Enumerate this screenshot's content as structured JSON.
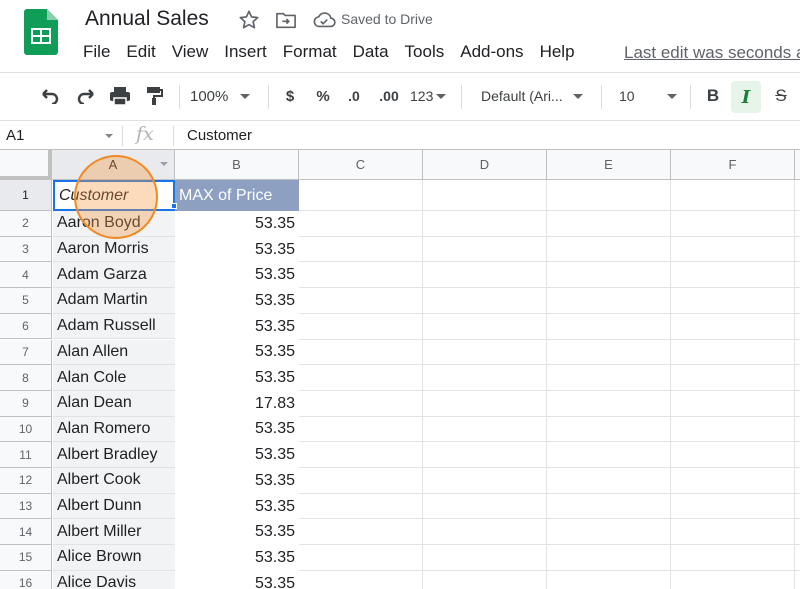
{
  "app": {
    "title": "Annual Sales",
    "saved_status": "Saved to Drive",
    "last_edit": "Last edit was seconds ago"
  },
  "menu": [
    "File",
    "Edit",
    "View",
    "Insert",
    "Format",
    "Data",
    "Tools",
    "Add-ons",
    "Help"
  ],
  "toolbar": {
    "zoom": "100%",
    "currency": "$",
    "percent": "%",
    "decrease_decimals": ".0",
    "increase_decimals": ".00",
    "more_formats": "123",
    "font": "Default (Ari...",
    "font_size": "10",
    "bold": "B",
    "italic": "I",
    "strikethrough": "S"
  },
  "formula_bar": {
    "cell_ref": "A1",
    "fx": "fx",
    "content": "Customer"
  },
  "columns": [
    "A",
    "B",
    "C",
    "D",
    "E",
    "F"
  ],
  "rows": [
    {
      "num": "1",
      "a": "Customer",
      "b": "MAX of Price"
    },
    {
      "num": "2",
      "a": "Aaron Boyd",
      "b": "53.35"
    },
    {
      "num": "3",
      "a": "Aaron Morris",
      "b": "53.35"
    },
    {
      "num": "4",
      "a": "Adam Garza",
      "b": "53.35"
    },
    {
      "num": "5",
      "a": "Adam Martin",
      "b": "53.35"
    },
    {
      "num": "6",
      "a": "Adam Russell",
      "b": "53.35"
    },
    {
      "num": "7",
      "a": "Alan Allen",
      "b": "53.35"
    },
    {
      "num": "8",
      "a": "Alan Cole",
      "b": "53.35"
    },
    {
      "num": "9",
      "a": "Alan Dean",
      "b": "17.83"
    },
    {
      "num": "10",
      "a": "Alan Romero",
      "b": "53.35"
    },
    {
      "num": "11",
      "a": "Albert Bradley",
      "b": "53.35"
    },
    {
      "num": "12",
      "a": "Albert Cook",
      "b": "53.35"
    },
    {
      "num": "13",
      "a": "Albert Dunn",
      "b": "53.35"
    },
    {
      "num": "14",
      "a": "Albert Miller",
      "b": "53.35"
    },
    {
      "num": "15",
      "a": "Alice Brown",
      "b": "53.35"
    },
    {
      "num": "16",
      "a": "Alice Davis",
      "b": "53.35"
    }
  ],
  "colors": {
    "accent": "#1a73e8",
    "header_fill": "#8da0c2",
    "sheets_green": "#0f9d58",
    "click_highlight": "#f08a24"
  }
}
